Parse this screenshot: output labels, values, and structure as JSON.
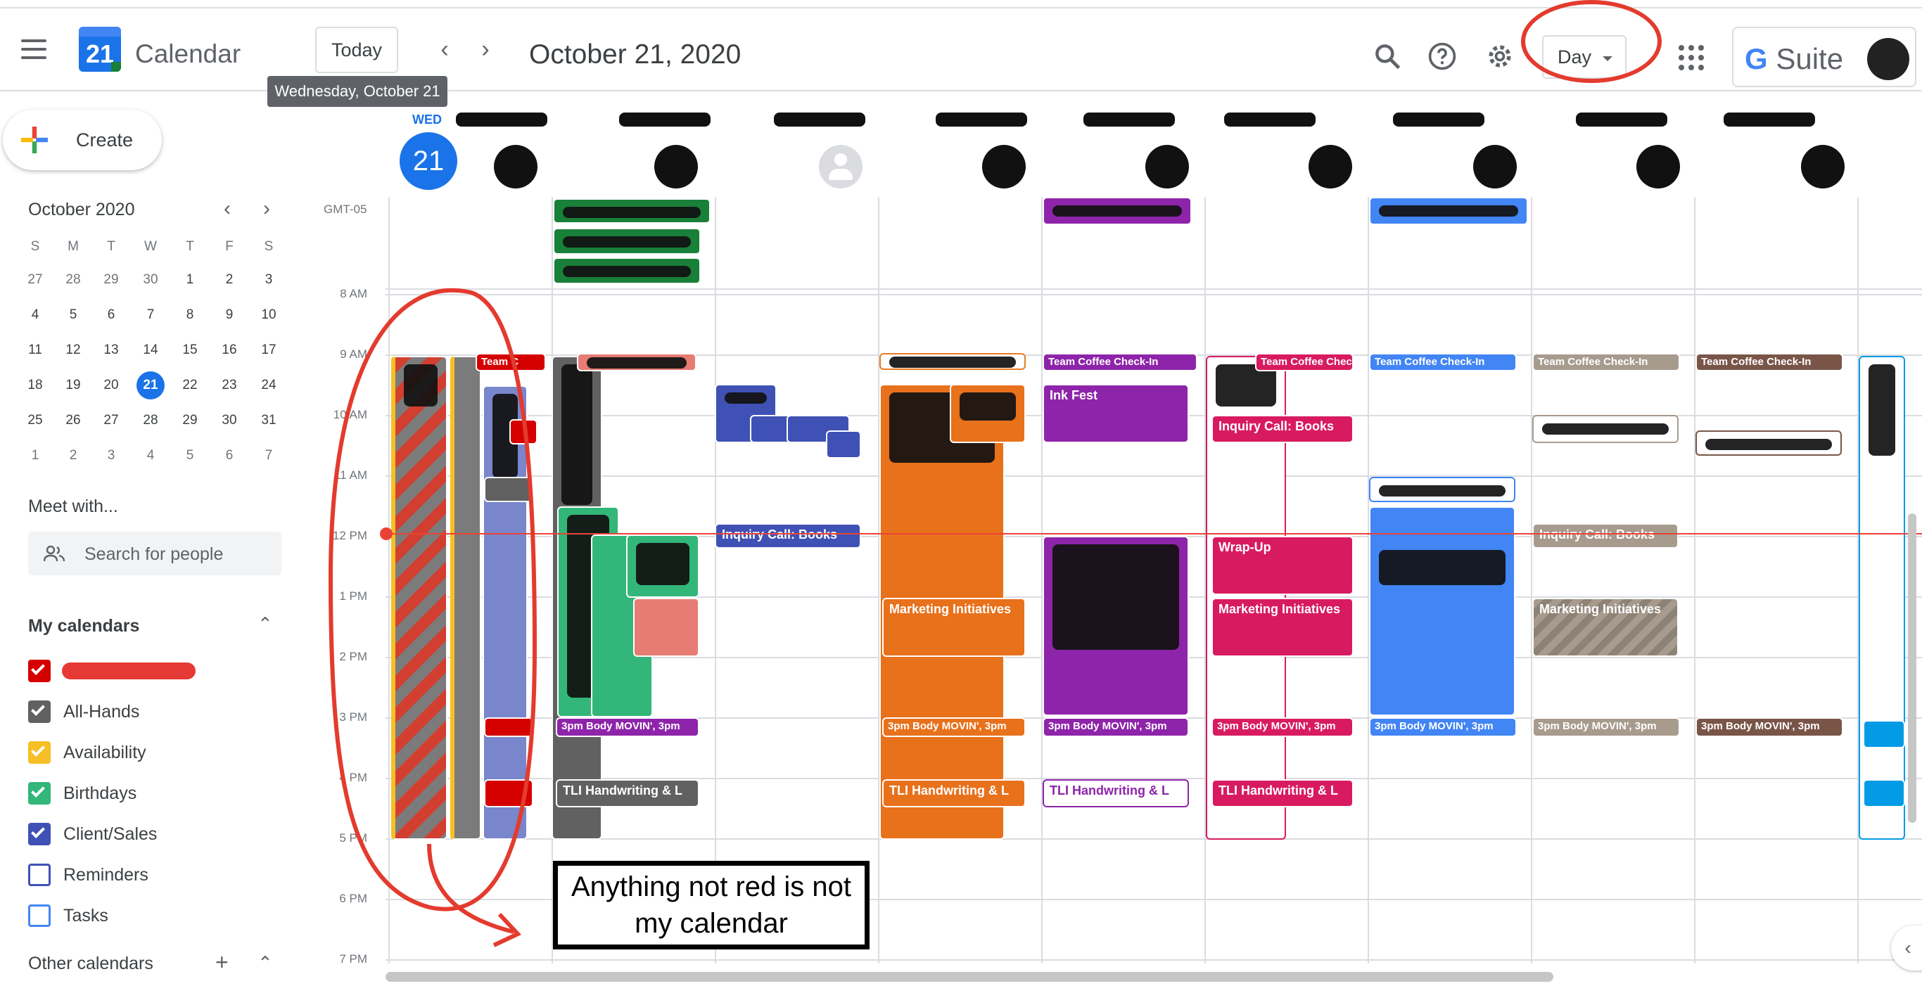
{
  "header": {
    "app_title": "Calendar",
    "logo_day": "21",
    "today_label": "Today",
    "date_title": "October 21, 2020",
    "tooltip": "Wednesday, October 21",
    "view_label": "Day",
    "suite_label": "Suite",
    "suite_g": "G"
  },
  "sidebar": {
    "create_label": "Create",
    "mini_cal": {
      "title": "October 2020",
      "dow": [
        "S",
        "M",
        "T",
        "W",
        "T",
        "F",
        "S"
      ],
      "weeks": [
        [
          "27",
          "28",
          "29",
          "30",
          "1",
          "2",
          "3"
        ],
        [
          "4",
          "5",
          "6",
          "7",
          "8",
          "9",
          "10"
        ],
        [
          "11",
          "12",
          "13",
          "14",
          "15",
          "16",
          "17"
        ],
        [
          "18",
          "19",
          "20",
          "21",
          "22",
          "23",
          "24"
        ],
        [
          "25",
          "26",
          "27",
          "28",
          "29",
          "30",
          "31"
        ],
        [
          "1",
          "2",
          "3",
          "4",
          "5",
          "6",
          "7"
        ]
      ],
      "today": "21"
    },
    "meet_title": "Meet with...",
    "people_placeholder": "Search for people",
    "my_calendars_title": "My calendars",
    "calendars": [
      {
        "label": "",
        "color": "#d50000",
        "checked": true,
        "redacted": true
      },
      {
        "label": "All-Hands",
        "color": "#616161",
        "checked": true
      },
      {
        "label": "Availability",
        "color": "#f6bf26",
        "checked": true
      },
      {
        "label": "Birthdays",
        "color": "#33b679",
        "checked": true
      },
      {
        "label": "Client/Sales",
        "color": "#3f51b5",
        "checked": true
      },
      {
        "label": "Reminders",
        "color": "#3f51b5",
        "checked": false
      },
      {
        "label": "Tasks",
        "color": "#4285f4",
        "checked": false
      }
    ],
    "other_calendars_title": "Other calendars"
  },
  "grid": {
    "day_of_week": "WED",
    "day_number": "21",
    "timezone": "GMT-05",
    "hours": [
      "8 AM",
      "9 AM",
      "10 AM",
      "11 AM",
      "12 PM",
      "1 PM",
      "2 PM",
      "3 PM",
      "4 PM",
      "5 PM",
      "6 PM",
      "7 PM"
    ]
  },
  "events": {
    "team_c": "Team C",
    "team_coffee": "Team Coffee Check-In",
    "inquiry_call": "Inquiry Call: Books",
    "marketing": "Marketing Initiatives",
    "body_movin": "3pm Body MOVIN', 3pm",
    "tli": "TLI Handwriting & L",
    "ink_fest": "Ink Fest",
    "wrap_up": "Wrap-Up"
  },
  "annotation": {
    "note": "Anything not red is not my calendar"
  },
  "colors": {
    "accent": "#1a73e8",
    "now_line": "#ea4335",
    "annotation_red": "#e33b2e"
  }
}
